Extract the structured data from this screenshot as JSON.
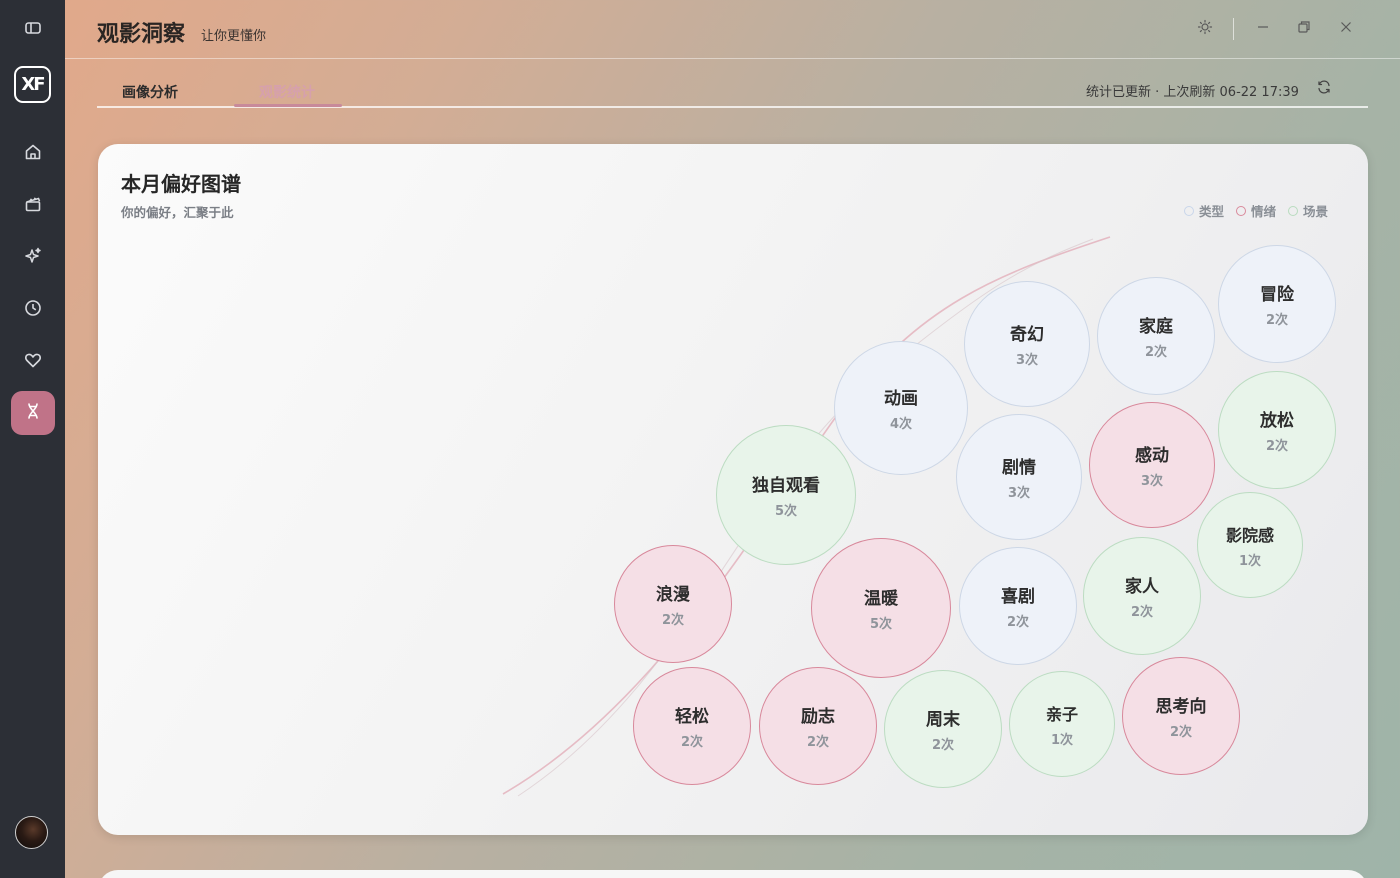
{
  "app": {
    "title": "观影洞察",
    "subtitle": "让你更懂你"
  },
  "sidebar": {
    "logo_text": "XF",
    "items": [
      {
        "icon": "home-icon"
      },
      {
        "icon": "clapperboard-icon"
      },
      {
        "icon": "sparkles-icon"
      },
      {
        "icon": "clock-icon"
      },
      {
        "icon": "heart-icon"
      },
      {
        "icon": "dna-icon",
        "active": true
      }
    ]
  },
  "tabs": [
    {
      "label": "画像分析"
    },
    {
      "label": "观影统计",
      "active": true
    }
  ],
  "status": {
    "text": "统计已更新 · 上次刷新 06-22 17:39"
  },
  "card": {
    "title": "本月偏好图谱",
    "subtitle": "你的偏好，汇聚于此",
    "legend": [
      {
        "label": "类型",
        "color": "#c9d6ea"
      },
      {
        "label": "情绪",
        "color": "#d98a9c"
      },
      {
        "label": "场景",
        "color": "#b9dcbf"
      }
    ]
  },
  "colors": {
    "type_fill": "#eef2f9",
    "type_stroke": "#cdd7e6",
    "emotion_fill": "#f5dfe6",
    "emotion_stroke": "#d8889b",
    "scene_fill": "#e8f4ea",
    "scene_stroke": "#bcdcc2",
    "accent": "#c07388"
  },
  "bubbles": [
    {
      "label": "冒险",
      "count": "2次",
      "category": "type"
    },
    {
      "label": "家庭",
      "count": "2次",
      "category": "type"
    },
    {
      "label": "奇幻",
      "count": "3次",
      "category": "type"
    },
    {
      "label": "动画",
      "count": "4次",
      "category": "type"
    },
    {
      "label": "放松",
      "count": "2次",
      "category": "scene"
    },
    {
      "label": "感动",
      "count": "3次",
      "category": "emotion"
    },
    {
      "label": "剧情",
      "count": "3次",
      "category": "type"
    },
    {
      "label": "独自观看",
      "count": "5次",
      "category": "scene"
    },
    {
      "label": "影院感",
      "count": "1次",
      "category": "scene"
    },
    {
      "label": "家人",
      "count": "2次",
      "category": "scene"
    },
    {
      "label": "喜剧",
      "count": "2次",
      "category": "type"
    },
    {
      "label": "温暖",
      "count": "5次",
      "category": "emotion"
    },
    {
      "label": "浪漫",
      "count": "2次",
      "category": "emotion"
    },
    {
      "label": "思考向",
      "count": "2次",
      "category": "emotion"
    },
    {
      "label": "亲子",
      "count": "1次",
      "category": "scene"
    },
    {
      "label": "周末",
      "count": "2次",
      "category": "scene"
    },
    {
      "label": "励志",
      "count": "2次",
      "category": "emotion"
    },
    {
      "label": "轻松",
      "count": "2次",
      "category": "emotion"
    }
  ]
}
